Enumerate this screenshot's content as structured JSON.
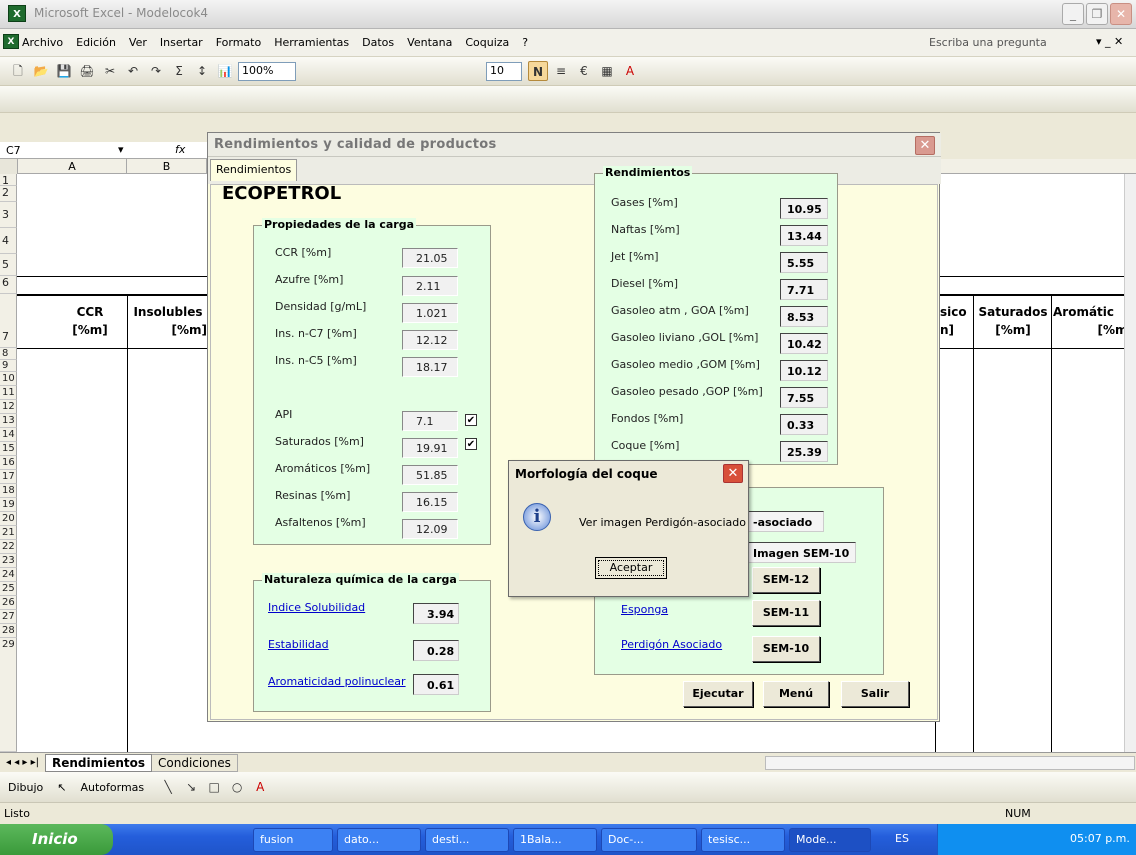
{
  "window": {
    "title": "Microsoft Excel - Modelocok4"
  },
  "menu": [
    "Archivo",
    "Edición",
    "Ver",
    "Insertar",
    "Formato",
    "Herramientas",
    "Datos",
    "Ventana",
    "Coquiza",
    "?"
  ],
  "ask_placeholder": "Escriba una pregunta",
  "toolbar": {
    "zoom": "100%",
    "font_size": "10"
  },
  "namebox": "C7",
  "fx": "fx",
  "columns": [
    "A",
    "B"
  ],
  "rows": [
    "1",
    "2",
    "3",
    "4",
    "5",
    "6",
    "7",
    "8",
    "9",
    "10",
    "11",
    "12",
    "13",
    "14",
    "15",
    "16",
    "17",
    "18",
    "19",
    "20",
    "21",
    "22",
    "23",
    "24",
    "25",
    "26",
    "27",
    "28",
    "29"
  ],
  "sheet_headers": {
    "ccr": "CCR",
    "ccr_unit": "[%m]",
    "insolubles": "Insolubles",
    "insolubles_unit": "[%m]",
    "sico": "sico",
    "sico_unit": "n]",
    "saturados": "Saturados",
    "saturados_unit": "[%m]",
    "aromaticos": "Aromátic",
    "aromaticos_unit": "[%m]"
  },
  "sheet_tabs": [
    "Rendimientos",
    "Condiciones"
  ],
  "drawbar": {
    "dibujo": "Dibujo",
    "autoformas": "Autoformas"
  },
  "status": {
    "left": "Listo",
    "num": "NUM"
  },
  "taskbar": {
    "start": "Inicio",
    "tasks": [
      "fusion",
      "dato...",
      "desti...",
      "1Bala...",
      "Doc-...",
      "tesisc...",
      "Mode..."
    ],
    "lang": "ES",
    "clock": "05:07 p.m."
  },
  "dialog": {
    "title": "Rendimientos y calidad de productos",
    "tab": "Rendimientos",
    "logo": "ECOPETROL",
    "propiedades": {
      "title": "Propiedades de la carga",
      "items": [
        {
          "label": "CCR  [%m]",
          "value": "21.05"
        },
        {
          "label": "Azufre [%m]",
          "value": "2.11"
        },
        {
          "label": "Densidad  [g/mL]",
          "value": "1.021"
        },
        {
          "label": "Ins. n-C7  [%m]",
          "value": "12.12"
        },
        {
          "label": "Ins. n-C5 [%m]",
          "value": "18.17"
        }
      ],
      "items2": [
        {
          "label": "API",
          "value": "7.1",
          "checked": true
        },
        {
          "label": "Saturados [%m]",
          "value": "19.91",
          "checked": true
        },
        {
          "label": "Aromáticos [%m]",
          "value": "51.85"
        },
        {
          "label": "Resinas [%m]",
          "value": "16.15"
        },
        {
          "label": "Asfaltenos [%m]",
          "value": "12.09"
        }
      ]
    },
    "naturaleza": {
      "title": "Naturaleza química de la carga",
      "items": [
        {
          "label": "Indice Solubilidad",
          "value": "3.94"
        },
        {
          "label": "Estabilidad",
          "value": "0.28"
        },
        {
          "label": "Aromaticidad polinuclear",
          "value": "0.61"
        }
      ]
    },
    "rendimientos": {
      "title": "Rendimientos",
      "items": [
        {
          "label": "Gases [%m]",
          "value": "10.95"
        },
        {
          "label": "Naftas [%m]",
          "value": "13.44"
        },
        {
          "label": "Jet [%m]",
          "value": "5.55"
        },
        {
          "label": "Diesel [%m]",
          "value": "7.71"
        },
        {
          "label": "Gasoleo atm , GOA [%m]",
          "value": "8.53"
        },
        {
          "label": "Gasoleo liviano ,GOL [%m]",
          "value": "10.42"
        },
        {
          "label": "Gasoleo medio ,GOM [%m]",
          "value": "10.12"
        },
        {
          "label": "Gasoleo pesado ,GOP [%m]",
          "value": "7.55"
        },
        {
          "label": "Fondos [%m]",
          "value": "0.33"
        },
        {
          "label": "Coque [%m]",
          "value": "25.39"
        }
      ]
    },
    "morfologia": {
      "box1": "-asociado",
      "box2": "Imagen SEM-10",
      "links": [
        {
          "label": "Esponga",
          "sem": "SEM-11"
        },
        {
          "label": "Perdigón Asociado",
          "sem": "SEM-10"
        }
      ],
      "sem12": "SEM-12"
    },
    "buttons": {
      "ejecutar": "Ejecutar",
      "menu": "Menú",
      "salir": "Salir"
    }
  },
  "msgbox": {
    "title": "Morfología del coque",
    "text": "Ver imagen Perdigón-asociado",
    "ok": "Aceptar"
  }
}
